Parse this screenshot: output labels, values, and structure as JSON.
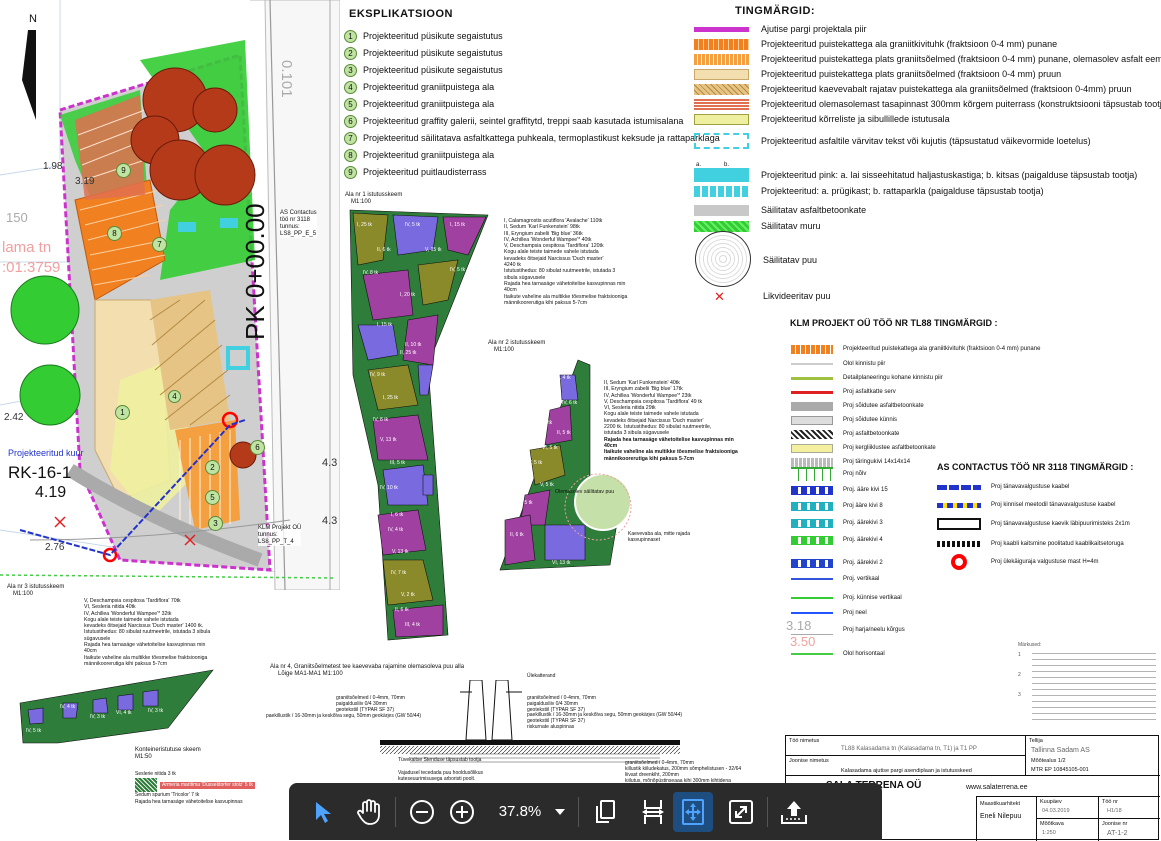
{
  "map": {
    "north": "N",
    "cadastral": [
      "1.98",
      "3.19",
      "150",
      "lama tn",
      ":01:3759",
      "2.42",
      "2.76",
      "4.3",
      "4.3"
    ],
    "station": "PK 0+00.00",
    "km_label": "0.101",
    "rk_label": "RK-16-1",
    "rk_value": "4.19",
    "proj_kuur": "Projekteeritud kuur",
    "as_contactus_note": [
      "AS Contactus",
      "töö nr 3118",
      "tunnus:",
      "LS8_PP_E_5"
    ],
    "klm_note": [
      "KLM Projekt OÜ",
      "tunnus:",
      "LS8_PP_T_4"
    ],
    "roman": [
      "II",
      "II",
      "II",
      "II",
      "II"
    ],
    "area_numbers": [
      "1",
      "2",
      "3",
      "4",
      "5",
      "6",
      "7",
      "8",
      "9"
    ]
  },
  "explanation": {
    "title": "EKSPLIKATSIOON",
    "items": [
      {
        "n": "1",
        "text": "Projekteeritud püsikute segaistutus"
      },
      {
        "n": "2",
        "text": "Projekteeritud püsikute segaistutus"
      },
      {
        "n": "3",
        "text": "Projekteeritud püsikute segaistutus"
      },
      {
        "n": "4",
        "text": "Projekteeritud graniitpuistega ala"
      },
      {
        "n": "5",
        "text": "Projekteeritud graniitpuistega ala"
      },
      {
        "n": "6",
        "text": "Projekteeritud graffity galerii, seintel graffitytd, treppi saab kasutada istumisalana"
      },
      {
        "n": "7",
        "text": "Projekteeritud säilitatava asfaltkattega puhkeala, termoplastikust keksude ja rattaparklaga"
      },
      {
        "n": "8",
        "text": "Projekteeritud graniitpuistega ala"
      },
      {
        "n": "9",
        "text": "Projekteeritud puitlaudisterrass"
      }
    ]
  },
  "legend": {
    "title": "TINGMÄRGID:",
    "items": [
      {
        "swatch": "#cc33cc",
        "text": "Ajutise pargi projektala piir"
      },
      {
        "swatch": "#f08020",
        "text": "Projekteeritud puistekattega ala graniitkivituhk (fraktsioon 0-4 mm) punane"
      },
      {
        "swatch": "#f4a040",
        "text": "Projekteeritud puistekattega plats graniitsõelmed (fraktsioon 0-4 mm) punane, olemasolev asfalt eemaldada"
      },
      {
        "swatch": "#f3deb0",
        "text": "Projekteeritud puistekattega plats graniitsõelmed (fraktsioon 0-4 mm) pruun"
      },
      {
        "swatch": "#e6c486",
        "text": "Projekteeritud kaevevabalt rajatav puistekattega ala graniitsõelmed (fraktsioon 0-4mm) pruun"
      },
      {
        "swatch": "#e07050",
        "text": "Projekteeritud olemasolemast tasapinnast 300mm kõrgem puiterrass (konstruktsiooni täpsustab tootja)"
      },
      {
        "swatch": "#eef0a0",
        "text": "Projekteeritud kõrreliste ja sibullillede istutusala"
      },
      {
        "swatch": "#40d0e0",
        "text": "Projekteeritud asfaltile värvitav tekst või kujutis (täpsustatud väikevormide loetelus)"
      },
      {
        "swatch": "#40d0e0",
        "text": "Projekteeritud pink: a. lai sisseehitatud haljastuskastiga; b. kitsas (paigalduse täpsustab tootja)"
      },
      {
        "swatch": "#40d0e0",
        "text": "Projekteeritud: a. prügikast; b. rattaparkla (paigalduse täpsustab tootja)"
      },
      {
        "swatch": "#c8c8c8",
        "text": "Säilitatav asfaltbetoonkate"
      },
      {
        "swatch": "#33cc33",
        "text": "Säilitatav muru"
      },
      {
        "swatch": "#ffffff",
        "text": "Säilitatav puu"
      },
      {
        "swatch": "#ffffff",
        "text": "Likvideeritav puu"
      }
    ],
    "ab": [
      "a.",
      "b."
    ]
  },
  "klm": {
    "title": "KLM PROJEKT OÜ TÖÖ NR TL88 TINGMÄRGID :",
    "items": [
      {
        "swatch": "#f08020",
        "text": "Projekteeritud puistekattega ala graniitkivituhk (fraktsioon 0-4 mm) punane"
      },
      {
        "swatch": "#cccccc",
        "text": "Olol kinnistu piir"
      },
      {
        "swatch": "#a0c040",
        "text": "Detailplaneeringu kohane kinnistu piir"
      },
      {
        "swatch": "#e02020",
        "text": "Proj asfaltkatte serv"
      },
      {
        "swatch": "#aaaaaa",
        "text": "Proj sõidutee asfaltbetoonkate"
      },
      {
        "swatch": "#dddddd",
        "text": "Proj sõidutee künnis"
      },
      {
        "swatch": "#222222",
        "text": "Proj asfaltbetoonkate"
      },
      {
        "swatch": "#f5f0a0",
        "text": "Proj kergliiklustee asfaltbetoonkate"
      },
      {
        "swatch": "#bbbbbb",
        "text": "Proj täringukivi 14x14x14"
      },
      {
        "swatch": "#33aa33",
        "text": "Proj nõlv"
      },
      {
        "swatch": "#2233cc",
        "text": "Proj. ääre kivi 15"
      },
      {
        "swatch": "#20b0c0",
        "text": "Proj ääre kivi 8"
      },
      {
        "swatch": "#20b0c0",
        "text": "Proj. äärekivi 3"
      },
      {
        "swatch": "#33cc33",
        "text": "Proj. äärekivi 4"
      },
      {
        "swatch": "#2244cc",
        "text": "Proj. äärekivi 2"
      },
      {
        "swatch": "#3355dd",
        "text": "Proj. vertikaal"
      },
      {
        "swatch": "#33cc33",
        "text": "Proj. künnise vertikaal"
      },
      {
        "swatch": "#2255ff",
        "text": "Proj neel"
      },
      {
        "swatch": "#aaaaaa",
        "text": "Proj harja/neelu kõrgus"
      },
      {
        "swatch": "#44cc44",
        "text": "Olol horisontaal"
      }
    ],
    "harja_values": [
      "3.18",
      "3.50"
    ]
  },
  "contactus": {
    "title": "AS CONTACTUS TÖÖ NR 3118 TINGMÄRGID :",
    "items": [
      {
        "text": "Proj tänavavalgustuse kaabel"
      },
      {
        "text": "Proj kinnisel meetodil tänavavalgustuse kaabel"
      },
      {
        "text": "Proj tänavavalgustuse kaevik läbipuurimisteks 2x1m"
      },
      {
        "text": "Proj kaabli kaitsmine poolitatud kaablikaitsetoruga"
      },
      {
        "text": "Proj ülekäiguraja valgustuse mast H=4m"
      }
    ]
  },
  "planting": {
    "plan1_title": "Ala nr 1 istutusskeem",
    "plan1_scale": "M1:100",
    "plan1_lines": [
      "I, Calamagrostis acutiflora 'Avalache' 110tk",
      "II, Sedum 'Karl Funkenstein' 98tk",
      "III, Eryngium zabelii 'Big blue' 36tk",
      "IV, Achillea 'Wonderful Wampee'* 40tk",
      "V, Deschampsia cespitosa 'Tardiflora' 120tk",
      "Kogu alale teiste taimede vahele istutada",
      "kevadeks õitsejaid Narcissus 'Duch master'",
      "4240 tk",
      "Istutustihedus: 80 sibulat ruutmeetrile, istutada 3",
      "sibula sügavusele",
      "Rajada hea tarnaságe vähetoitelise kasvupinnas min",
      "40cm",
      "Itaikute vaheline ala multikke tõesmelise fraktsiooniga",
      "männikoorerutiga kihi paksus 5-7cm"
    ],
    "plan1_cells": [
      "I, 25 tk",
      "IV, 5 tk",
      "I, 15 tk",
      "II, 6 tk",
      "V, 15 tk",
      "IV, 8 tk",
      "IV, 5 tk",
      "I, 20 tk",
      "I, 15 tk",
      "II, 25 tk",
      "IV, 9 tk",
      "I, 25 tk",
      "IV, 8 tk",
      "V, 13 tk",
      "III, 5 tk",
      "II, 10 tk",
      "IV, 10 tk",
      "I, 6 tk",
      "IV, 4 tk",
      "V, 13 tk",
      "IV, 7 tk",
      "V, 2 tk",
      "II, 6 tk",
      "III, 4 tk"
    ],
    "plan2_title": "Ala nr 2 istutusskeem",
    "plan2_scale": "M1:100",
    "plan2_lines": [
      "II, Sedum 'Karl Funkenstein' 40tk",
      "III, Eryngium zabelii 'Big blue' 17tk",
      "IV, Achillea 'Wonderful Wampee'* 23tk",
      "V, Deschampsia cespitosa 'Tardiflora' 49 tk",
      "VI, Sesleria nitida 29tk",
      "Kogu alale teiste taimede vahele istutada",
      "kevadeks õitsejaid Narcissus 'Duch master'",
      "2200 tk. Istutustihedus: 80 sibulat ruutmeetrile,",
      "istutada 3 sibula sügavusele",
      "Rajada hea tarnaságe vähetoitelise kasvupinnas min",
      "40cm",
      "Itaikute vaheline ala multikke tõesmelise fraktsiooniga",
      "männikoorerutiga kihi paksus 5-7cm"
    ],
    "plan2_cells": [
      "II, 4 tk",
      "IV, 6 tk",
      "IV, 7 tk",
      "II, 5 tk",
      "VI, 5 tk",
      "IV, 5 tk",
      "V, 5 tk",
      "VI, 5 tk",
      "II, 6 tk",
      "VI, 13 tk"
    ],
    "existing_tree": "Olemasolev säilitatav puu",
    "existing_tree_note": [
      "Kaevevaba ala, mitte rajada",
      "kasvupinnaset"
    ],
    "plan3_title": "Ala nr 3 istutusskeem",
    "plan3_scale": "M1:100",
    "plan3_lines": [
      "V, Deschampsia cespitosa 'Tardiflora' 70tk",
      "VI, Sesleria nitida 40tk",
      "IV, Achillea 'Wonderful Wampee'* 32tk",
      "Kogu alale teiste taimede vahele istutada",
      "kevadeks õitsejaid Narcissus 'Duch master' 1400 tk.",
      "Istutustihedus: 80 sibulat ruutmeetrile, istutada 3 sibula",
      "sügavusele",
      "Rajada hea tarnaságe vähetoitelise kasvupinnas min",
      "40cm",
      "Itaikute vaheline ala multikke tõesmelise fraktsiooniga",
      "männikoorerutiga kihi paksus 5-7cm"
    ],
    "plan3_cells": [
      "IV, 5 tk",
      "IV, 4 tk",
      "VI, 4 tk",
      "IV, 3 tk",
      "IV, 3 tk"
    ],
    "container_title": "Konteineristutuse skeem",
    "container_scale": "M1:50",
    "container_lines": [
      "Seslerie nitida 3 tk",
      "Armeria maritima 'Düsseldorfer stolz' 5 tk",
      "Sedum spurium 'Tricolor' 7 tk",
      "Rajada hea tarnaságe vähetoitelise kasvupinnas"
    ]
  },
  "section": {
    "title": "Ala nr 4, Graniitsõelmetest tee kaevevaba rajamine olemasoleva puu alla",
    "subtitle": "Lõige MA1-MA1 M1:100",
    "notes": [
      "graniitsõelmed / 0-4mm, 70mm",
      "paigaldusliiv 0/4 30mm",
      "geotekstiil (TYPAR SF 37)",
      "graniitsõelmed / 0-4mm, 70mm",
      "paigaldusliiv 0/4 30mm",
      "geotekstiil (TYPAR SF 37)",
      "paekillustik / 16-30mm ja keskõlva segu, 50mm geokärjes (GW 50/44)",
      "geotekstiil (TYPAR SF 37)",
      "riskurnate aluspinnas"
    ],
    "tree_label": "Tüvekaitse Stenduse täpsustab tootja",
    "note2": [
      "Vajadusel tecedada puu hooldusõlikus",
      "kuteseuurimisusega arboristi poolt."
    ],
    "road_lines": [
      "graniitsõelmed / 0-4mm, 70mm",
      "killustik kiiludekatus, 200mm sõmphelistusen - 32/64",
      "liivast dreenkiht, 200mm",
      "kiilutus, mõnõpüstinseaaa kihi 300mm kihtidena"
    ],
    "extra_label": "Ülekatterand"
  },
  "titleblock": {
    "work_name_label": "Töö nimetus",
    "work_name": "TL88 Kalasadama tn (Kalasadama tn, T1) ja T1 PP",
    "section_label": "Joonise nimetus",
    "section_name": "Kalasadama ajutise pargi asendiplaan ja istutusskeed",
    "company": "SALA TERRENA OÜ",
    "website": "www.salaterrena.ee",
    "client_label": "Tellija",
    "client": "Tallinna Sadam AS",
    "stage": "Mõõtealus 1/2",
    "mtr": "MTR EP 10845105-001",
    "specialist_label": "Maastikuarhitekt",
    "specialist": "Eneli Nilepuu",
    "date_label": "Kuupäev",
    "date": "04.03.2019",
    "work_no_label": "Töö nr",
    "work_no": "H1/18",
    "scale_label": "Mõõtkava",
    "scale": "1:250",
    "drawing_no_label": "Joonise nr",
    "drawing_no": "AT-1-2",
    "scattered": [
      "Sala Terrena OÜ",
      "Sala Terrena OÜ",
      "Eesti AS",
      "Tellija"
    ]
  },
  "notes_right": {
    "title": "Märkused:",
    "items": [
      "1",
      "2",
      "3"
    ]
  },
  "toolbar": {
    "zoom": "37.8%",
    "buttons": [
      "select-tool",
      "hand-tool",
      "zoom-out",
      "zoom-in",
      "zoom-dropdown",
      "page-view",
      "fit-width",
      "fit-page",
      "fullscreen",
      "upload"
    ]
  },
  "colors": {
    "grass": "#33cc33",
    "magenta": "#cc33cc",
    "tree": "#b43a1a",
    "plan_green": "#2e7d3a",
    "plan_purple": "#a040a0",
    "plan_olive": "#8a8a2a",
    "plan_violet": "#7a6ae0",
    "toolbar_bg": "#2b2b2b",
    "accent_blue": "#4da3ff"
  }
}
